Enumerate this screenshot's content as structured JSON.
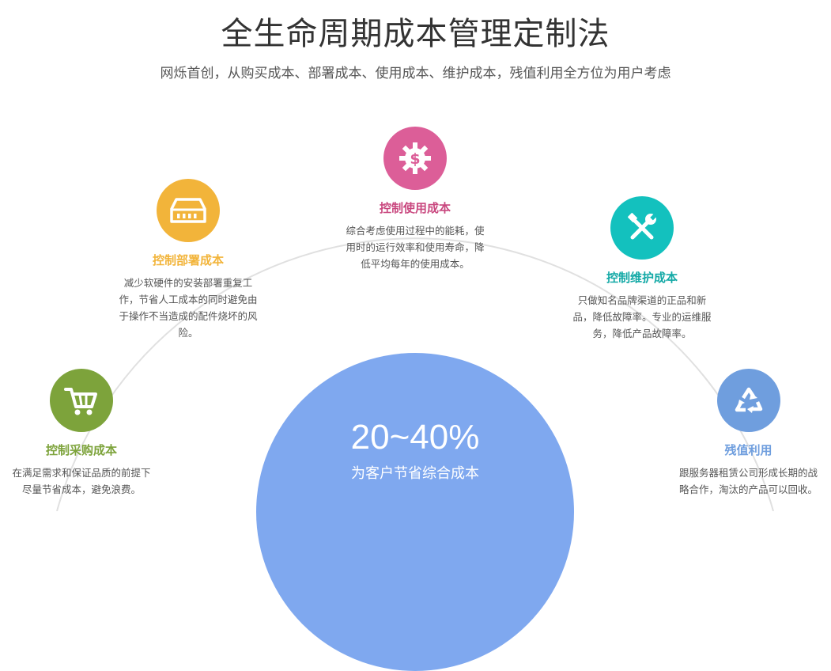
{
  "header": {
    "title": "全生命周期成本管理定制法",
    "subtitle": "网烁首创，从购买成本、部署成本、使用成本、维护成本，残值利用全方位为用户考虑"
  },
  "colors": {
    "purchase": "#7da33b",
    "deploy": "#f2b43a",
    "usage": "#dc5e98",
    "maintain": "#13c1be",
    "residual": "#6f9ede",
    "savings": "#7fa8ef",
    "arc": "#e0e0e0"
  },
  "nodes": {
    "purchase": {
      "icon": "shopping-cart-icon",
      "title": "控制采购成本",
      "desc": [
        "在满足需求和保证品质的前提下",
        "尽量节省成本，避免浪费。"
      ]
    },
    "deploy": {
      "icon": "server-icon",
      "title": "控制部署成本",
      "desc": [
        "减少软硬件的安装部署重复工",
        "作，节省人工成本的同时避免由",
        "于操作不当造成的配件烧坏的风",
        "险。"
      ]
    },
    "usage": {
      "icon": "dollar-gear-icon",
      "title": "控制使用成本",
      "desc": [
        "综合考虑使用过程中的能耗，使",
        "用时的运行效率和使用寿命，降",
        "低平均每年的使用成本。"
      ]
    },
    "maintain": {
      "icon": "tools-icon",
      "title": "控制维护成本",
      "desc": [
        "只做知名品牌渠道的正品和新",
        "品，降低故障率。专业的运维服",
        "务，降低产品故障率。"
      ]
    },
    "residual": {
      "icon": "recycle-icon",
      "title": "残值利用",
      "desc": [
        "跟服务器租赁公司形成长期的战",
        "略合作，淘汰的产品可以回收。"
      ]
    }
  },
  "savings": {
    "range": "20~40%",
    "label": "为客户节省综合成本"
  }
}
